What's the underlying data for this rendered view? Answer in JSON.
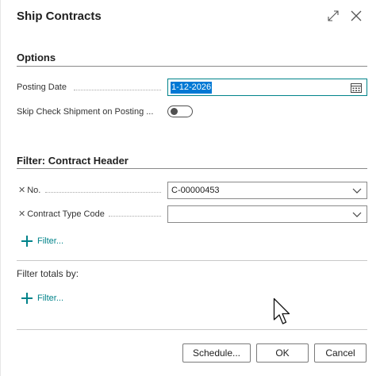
{
  "dialog": {
    "title": "Ship Contracts",
    "expand_icon": "expand-icon",
    "close_icon": "close-icon"
  },
  "options": {
    "heading": "Options",
    "posting_date_label": "Posting Date",
    "posting_date_value": "1-12-2026",
    "skip_check_label": "Skip Check Shipment on Posting ...",
    "skip_check_on": false
  },
  "filter": {
    "heading": "Filter: Contract Header",
    "no_label": "No.",
    "no_value": "C-00000453",
    "type_label": "Contract Type Code",
    "type_value": "",
    "add_filter_label": "Filter..."
  },
  "totals": {
    "label": "Filter totals by:",
    "add_filter_label": "Filter..."
  },
  "buttons": {
    "schedule": "Schedule...",
    "ok": "OK",
    "cancel": "Cancel"
  },
  "colors": {
    "accent": "#00838a",
    "selection": "#0078d4"
  }
}
